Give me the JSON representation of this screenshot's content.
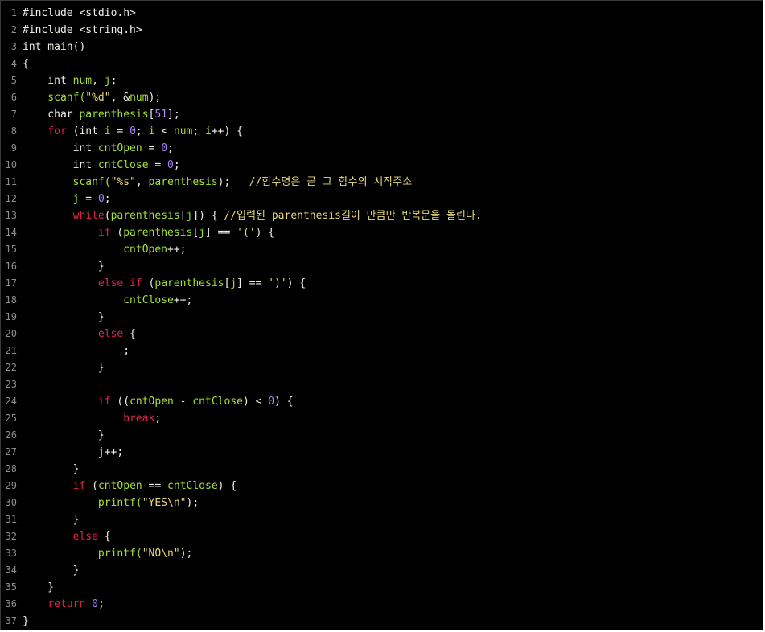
{
  "editor": {
    "background": "#000000",
    "colors": {
      "keyword": "#e4224a",
      "identifier": "#a6e22e",
      "string": "#e6db74",
      "number": "#ae81ff",
      "plain": "#f0f0e8",
      "line_number": "#8e8e8e"
    },
    "lines": [
      {
        "n": "1",
        "tokens": [
          {
            "t": "#include <stdio.h>",
            "c": "pp"
          }
        ]
      },
      {
        "n": "2",
        "tokens": [
          {
            "t": "#include <string.h>",
            "c": "pp"
          }
        ]
      },
      {
        "n": "3",
        "tokens": [
          {
            "t": "int main()",
            "c": "ty"
          }
        ]
      },
      {
        "n": "4",
        "tokens": [
          {
            "t": "{",
            "c": "op"
          }
        ]
      },
      {
        "n": "5",
        "tokens": [
          {
            "t": "    int ",
            "c": "ty"
          },
          {
            "t": "num",
            "c": "id"
          },
          {
            "t": ", ",
            "c": "op"
          },
          {
            "t": "j",
            "c": "id"
          },
          {
            "t": ";",
            "c": "op"
          }
        ]
      },
      {
        "n": "6",
        "tokens": [
          {
            "t": "    scanf(",
            "c": "id"
          },
          {
            "t": "\"%d\"",
            "c": "st"
          },
          {
            "t": ", &",
            "c": "op"
          },
          {
            "t": "num",
            "c": "id"
          },
          {
            "t": ");",
            "c": "op"
          }
        ]
      },
      {
        "n": "7",
        "tokens": [
          {
            "t": "    char ",
            "c": "ty"
          },
          {
            "t": "parenthesis",
            "c": "id"
          },
          {
            "t": "[",
            "c": "op"
          },
          {
            "t": "51",
            "c": "nu"
          },
          {
            "t": "];",
            "c": "op"
          }
        ]
      },
      {
        "n": "8",
        "tokens": [
          {
            "t": "    ",
            "c": "op"
          },
          {
            "t": "for",
            "c": "kw"
          },
          {
            "t": " (int ",
            "c": "ty"
          },
          {
            "t": "i",
            "c": "id"
          },
          {
            "t": " = ",
            "c": "op"
          },
          {
            "t": "0",
            "c": "nu"
          },
          {
            "t": "; ",
            "c": "op"
          },
          {
            "t": "i",
            "c": "id"
          },
          {
            "t": " < ",
            "c": "op"
          },
          {
            "t": "num",
            "c": "id"
          },
          {
            "t": "; ",
            "c": "op"
          },
          {
            "t": "i",
            "c": "id"
          },
          {
            "t": "++) {",
            "c": "op"
          }
        ]
      },
      {
        "n": "9",
        "tokens": [
          {
            "t": "        int ",
            "c": "ty"
          },
          {
            "t": "cntOpen",
            "c": "id"
          },
          {
            "t": " = ",
            "c": "op"
          },
          {
            "t": "0",
            "c": "nu"
          },
          {
            "t": ";",
            "c": "op"
          }
        ]
      },
      {
        "n": "10",
        "tokens": [
          {
            "t": "        int ",
            "c": "ty"
          },
          {
            "t": "cntClose",
            "c": "id"
          },
          {
            "t": " = ",
            "c": "op"
          },
          {
            "t": "0",
            "c": "nu"
          },
          {
            "t": ";",
            "c": "op"
          }
        ]
      },
      {
        "n": "11",
        "tokens": [
          {
            "t": "        scanf(",
            "c": "id"
          },
          {
            "t": "\"%s\"",
            "c": "st"
          },
          {
            "t": ", ",
            "c": "op"
          },
          {
            "t": "parenthesis",
            "c": "id"
          },
          {
            "t": ");   ",
            "c": "op"
          },
          {
            "t": "//함수명은 곧 그 함수의 시작주소",
            "c": "cm"
          }
        ]
      },
      {
        "n": "12",
        "tokens": [
          {
            "t": "        j",
            "c": "id"
          },
          {
            "t": " = ",
            "c": "op"
          },
          {
            "t": "0",
            "c": "nu"
          },
          {
            "t": ";",
            "c": "op"
          }
        ]
      },
      {
        "n": "13",
        "tokens": [
          {
            "t": "        ",
            "c": "op"
          },
          {
            "t": "while",
            "c": "kw"
          },
          {
            "t": "(",
            "c": "op"
          },
          {
            "t": "parenthesis",
            "c": "id"
          },
          {
            "t": "[",
            "c": "op"
          },
          {
            "t": "j",
            "c": "id"
          },
          {
            "t": "]) { ",
            "c": "op"
          },
          {
            "t": "//입력된 parenthesis길이 만큼만 반복문을 돌린다.",
            "c": "cm"
          }
        ]
      },
      {
        "n": "14",
        "tokens": [
          {
            "t": "            ",
            "c": "op"
          },
          {
            "t": "if",
            "c": "kw"
          },
          {
            "t": " (",
            "c": "op"
          },
          {
            "t": "parenthesis",
            "c": "id"
          },
          {
            "t": "[",
            "c": "op"
          },
          {
            "t": "j",
            "c": "id"
          },
          {
            "t": "] == ",
            "c": "op"
          },
          {
            "t": "'('",
            "c": "st"
          },
          {
            "t": ") {",
            "c": "op"
          }
        ]
      },
      {
        "n": "15",
        "tokens": [
          {
            "t": "                cntOpen",
            "c": "id"
          },
          {
            "t": "++;",
            "c": "op"
          }
        ]
      },
      {
        "n": "16",
        "tokens": [
          {
            "t": "            }",
            "c": "op"
          }
        ]
      },
      {
        "n": "17",
        "tokens": [
          {
            "t": "            ",
            "c": "op"
          },
          {
            "t": "else if",
            "c": "kw"
          },
          {
            "t": " (",
            "c": "op"
          },
          {
            "t": "parenthesis",
            "c": "id"
          },
          {
            "t": "[",
            "c": "op"
          },
          {
            "t": "j",
            "c": "id"
          },
          {
            "t": "] == ",
            "c": "op"
          },
          {
            "t": "')'",
            "c": "st"
          },
          {
            "t": ") {",
            "c": "op"
          }
        ]
      },
      {
        "n": "18",
        "tokens": [
          {
            "t": "                cntClose",
            "c": "id"
          },
          {
            "t": "++;",
            "c": "op"
          }
        ]
      },
      {
        "n": "19",
        "tokens": [
          {
            "t": "            }",
            "c": "op"
          }
        ]
      },
      {
        "n": "20",
        "tokens": [
          {
            "t": "            ",
            "c": "op"
          },
          {
            "t": "else",
            "c": "kw"
          },
          {
            "t": " {",
            "c": "op"
          }
        ]
      },
      {
        "n": "21",
        "tokens": [
          {
            "t": "                ;",
            "c": "op"
          }
        ]
      },
      {
        "n": "22",
        "tokens": [
          {
            "t": "            }",
            "c": "op"
          }
        ]
      },
      {
        "n": "23",
        "tokens": [
          {
            "t": "",
            "c": "op"
          }
        ]
      },
      {
        "n": "24",
        "tokens": [
          {
            "t": "            ",
            "c": "op"
          },
          {
            "t": "if",
            "c": "kw"
          },
          {
            "t": " ((",
            "c": "op"
          },
          {
            "t": "cntOpen",
            "c": "id"
          },
          {
            "t": " - ",
            "c": "op"
          },
          {
            "t": "cntClose",
            "c": "id"
          },
          {
            "t": ") < ",
            "c": "op"
          },
          {
            "t": "0",
            "c": "nu"
          },
          {
            "t": ") {",
            "c": "op"
          }
        ]
      },
      {
        "n": "25",
        "tokens": [
          {
            "t": "                ",
            "c": "op"
          },
          {
            "t": "break",
            "c": "kw"
          },
          {
            "t": ";",
            "c": "op"
          }
        ]
      },
      {
        "n": "26",
        "tokens": [
          {
            "t": "            }",
            "c": "op"
          }
        ]
      },
      {
        "n": "27",
        "tokens": [
          {
            "t": "            j",
            "c": "id"
          },
          {
            "t": "++;",
            "c": "op"
          }
        ]
      },
      {
        "n": "28",
        "tokens": [
          {
            "t": "        }",
            "c": "op"
          }
        ]
      },
      {
        "n": "29",
        "tokens": [
          {
            "t": "        ",
            "c": "op"
          },
          {
            "t": "if",
            "c": "kw"
          },
          {
            "t": " (",
            "c": "op"
          },
          {
            "t": "cntOpen",
            "c": "id"
          },
          {
            "t": " == ",
            "c": "op"
          },
          {
            "t": "cntClose",
            "c": "id"
          },
          {
            "t": ") {",
            "c": "op"
          }
        ]
      },
      {
        "n": "30",
        "tokens": [
          {
            "t": "            printf(",
            "c": "id"
          },
          {
            "t": "\"YES\\n\"",
            "c": "st"
          },
          {
            "t": ");",
            "c": "op"
          }
        ]
      },
      {
        "n": "31",
        "tokens": [
          {
            "t": "        }",
            "c": "op"
          }
        ]
      },
      {
        "n": "32",
        "tokens": [
          {
            "t": "        ",
            "c": "op"
          },
          {
            "t": "else",
            "c": "kw"
          },
          {
            "t": " {",
            "c": "op"
          }
        ]
      },
      {
        "n": "33",
        "tokens": [
          {
            "t": "            printf(",
            "c": "id"
          },
          {
            "t": "\"NO\\n\"",
            "c": "st"
          },
          {
            "t": ");",
            "c": "op"
          }
        ]
      },
      {
        "n": "34",
        "tokens": [
          {
            "t": "        }",
            "c": "op"
          }
        ]
      },
      {
        "n": "35",
        "tokens": [
          {
            "t": "    }",
            "c": "op"
          }
        ]
      },
      {
        "n": "36",
        "tokens": [
          {
            "t": "    ",
            "c": "op"
          },
          {
            "t": "return",
            "c": "kw"
          },
          {
            "t": " ",
            "c": "op"
          },
          {
            "t": "0",
            "c": "nu"
          },
          {
            "t": ";",
            "c": "op"
          }
        ]
      },
      {
        "n": "37",
        "tokens": [
          {
            "t": "}",
            "c": "op"
          }
        ]
      }
    ]
  }
}
